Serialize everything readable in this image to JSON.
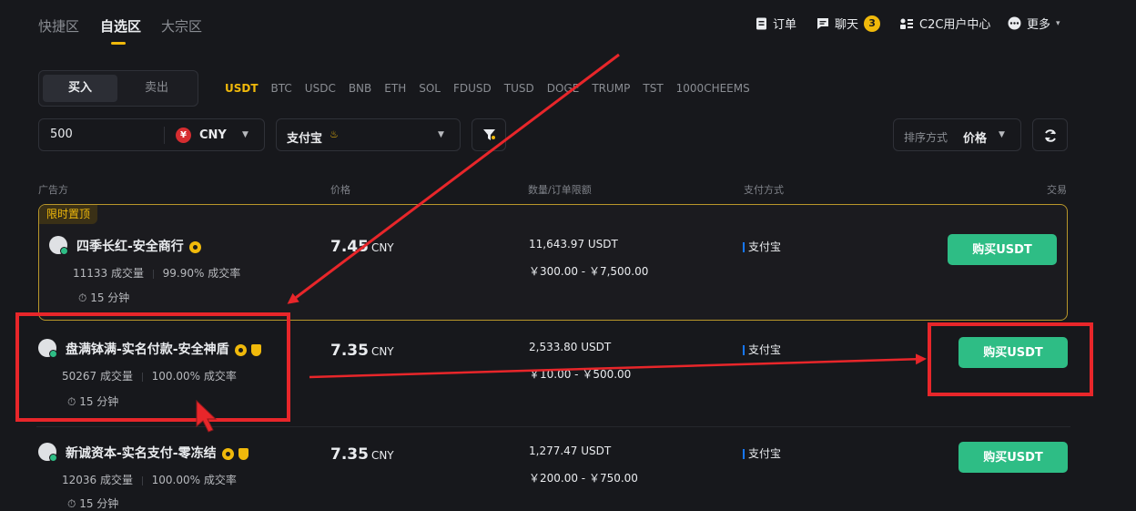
{
  "nav": {
    "tabs": [
      "快捷区",
      "自选区",
      "大宗区"
    ],
    "orders": "订单",
    "chat": "聊天",
    "chat_count": "3",
    "c2c_center": "C2C用户中心",
    "more": "更多"
  },
  "trade_toggle": {
    "buy": "买入",
    "sell": "卖出"
  },
  "coins": [
    "USDT",
    "BTC",
    "USDC",
    "BNB",
    "ETH",
    "SOL",
    "FDUSD",
    "TUSD",
    "DOGE",
    "TRUMP",
    "TST",
    "1000CHEEMS"
  ],
  "filters": {
    "amount": "500",
    "fiat": "CNY",
    "fiat_symbol": "¥",
    "payment": "支付宝",
    "sort_label": "排序方式",
    "sort_value": "价格"
  },
  "table_header": {
    "advertiser": "广告方",
    "price": "价格",
    "limits": "数量/订单限额",
    "payment": "支付方式",
    "trade": "交易"
  },
  "promo_tag": "限时置顶",
  "rows": [
    {
      "name": "四季长红-安全商行",
      "orders": "11133 成交量",
      "rate": "99.90% 成交率",
      "time": "15 分钟",
      "price": "7.45",
      "currency": "CNY",
      "amount": "11,643.97 USDT",
      "limit": "￥300.00 - ￥7,500.00",
      "payment": "支付宝",
      "button": "购买USDT"
    },
    {
      "name": "盘满钵满-实名付款-安全神盾",
      "orders": "50267 成交量",
      "rate": "100.00% 成交率",
      "time": "15 分钟",
      "price": "7.35",
      "currency": "CNY",
      "amount": "2,533.80 USDT",
      "limit": "￥10.00 - ￥500.00",
      "payment": "支付宝",
      "button": "购买USDT"
    },
    {
      "name": "新诚资本-实名支付-零冻结",
      "orders": "12036 成交量",
      "rate": "100.00% 成交率",
      "time": "15 分钟",
      "price": "7.35",
      "currency": "CNY",
      "amount": "1,277.47 USDT",
      "limit": "￥200.00 - ￥750.00",
      "payment": "支付宝",
      "button": "购买USDT"
    }
  ],
  "colors": {
    "background": "#17181c",
    "accent": "#f0b90b",
    "buy_green": "#2ebd85",
    "annotation_red": "#e8262a"
  }
}
